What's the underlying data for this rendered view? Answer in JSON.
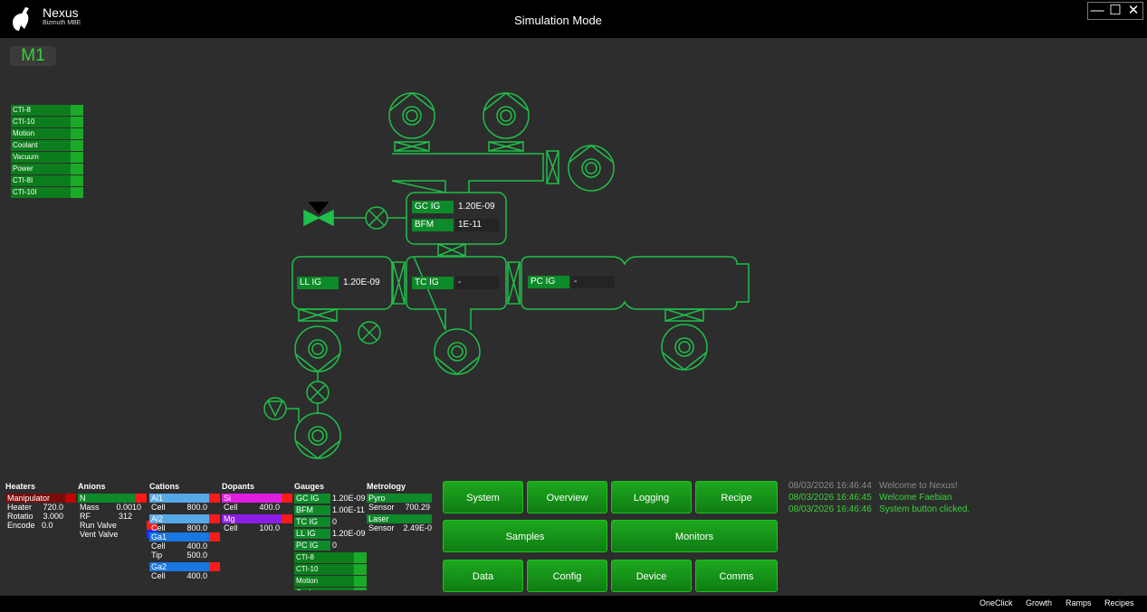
{
  "window": {
    "app_name": "Nexus",
    "app_subtitle": "Bizmuth MBE",
    "title": "Simulation Mode",
    "controls": [
      "—",
      "☐",
      "✕"
    ]
  },
  "mode_badge": "M1",
  "status_list": [
    "CTI-8",
    "CTI-10",
    "Motion",
    "Coolant",
    "Vacuum",
    "Power",
    "CTI-8I",
    "CTI-10I"
  ],
  "schematic": {
    "gc_ig": {
      "label": "GC IG",
      "value": "1.20E-09"
    },
    "bfm": {
      "label": "BFM",
      "value": "1E-11"
    },
    "ll_ig": {
      "label": "LL IG",
      "value": "1.20E-09"
    },
    "tc_ig": {
      "label": "TC IG",
      "value": "-"
    },
    "pc_ig": {
      "label": "PC IG",
      "value": "-"
    }
  },
  "panels": {
    "heaters": {
      "title": "Heaters",
      "header": "Manipulator",
      "rows": [
        [
          "Heater",
          "720.0"
        ],
        [
          "Rotatio",
          "3.000"
        ],
        [
          "Encode",
          "0.0"
        ]
      ]
    },
    "anions": {
      "title": "Anions",
      "header": "N",
      "rows": [
        [
          "Mass",
          "0.0010"
        ],
        [
          "RF",
          "312"
        ],
        [
          "Run Valve",
          ""
        ],
        [
          "Vent Valve",
          ""
        ]
      ]
    },
    "cations": {
      "title": "Cations",
      "items": [
        {
          "name": "Al1",
          "rows": [
            [
              "Cell",
              "800.0"
            ]
          ]
        },
        {
          "name": "Al2",
          "rows": [
            [
              "Cell",
              "800.0"
            ]
          ]
        },
        {
          "name": "Ga1",
          "rows": [
            [
              "Cell",
              "400.0"
            ],
            [
              "Tip",
              "500.0"
            ]
          ]
        },
        {
          "name": "Ga2",
          "rows": [
            [
              "Cell",
              "400.0"
            ]
          ]
        }
      ]
    },
    "dopants": {
      "title": "Dopants",
      "items": [
        {
          "name": "Si",
          "rows": [
            [
              "Cell",
              "400.0"
            ]
          ]
        },
        {
          "name": "Mg",
          "rows": [
            [
              "Cell",
              "100.0"
            ]
          ]
        }
      ]
    },
    "gauges": {
      "title": "Gauges",
      "items": [
        [
          "GC IG",
          "1.20E-09"
        ],
        [
          "BFM",
          "1.00E-11"
        ],
        [
          "TC IG",
          "0"
        ],
        [
          "LL IG",
          "1.20E-09"
        ],
        [
          "PC IG",
          "0"
        ]
      ],
      "status": [
        "CTI-8",
        "CTI-10",
        "Motion",
        "Coolant"
      ]
    },
    "metrology": {
      "title": "Metrology",
      "items": [
        {
          "name": "Pyro",
          "rows": [
            [
              "Sensor",
              "700.29"
            ]
          ]
        },
        {
          "name": "Laser",
          "rows": [
            [
              "Sensor",
              "2.49E-0"
            ]
          ]
        }
      ]
    }
  },
  "buttons": [
    "System",
    "Overview",
    "Logging",
    "Recipe",
    "Samples",
    "Monitors",
    "Data",
    "Config",
    "Device",
    "Comms"
  ],
  "log": [
    {
      "time": "08/03/2026 16:46:44",
      "msg": "Welcome to Nexus!"
    },
    {
      "time": "08/03/2026 16:46:45",
      "msg": "Welcome Faebian"
    },
    {
      "time": "08/03/2026 16:46:46",
      "msg": "System button clicked."
    }
  ],
  "bottom_links": [
    "OneClick",
    "Growth",
    "Ramps",
    "Recipes"
  ],
  "colors": {
    "accent": "#1aaa28",
    "line": "#1fbf4a",
    "red": "#ff1a1a"
  }
}
